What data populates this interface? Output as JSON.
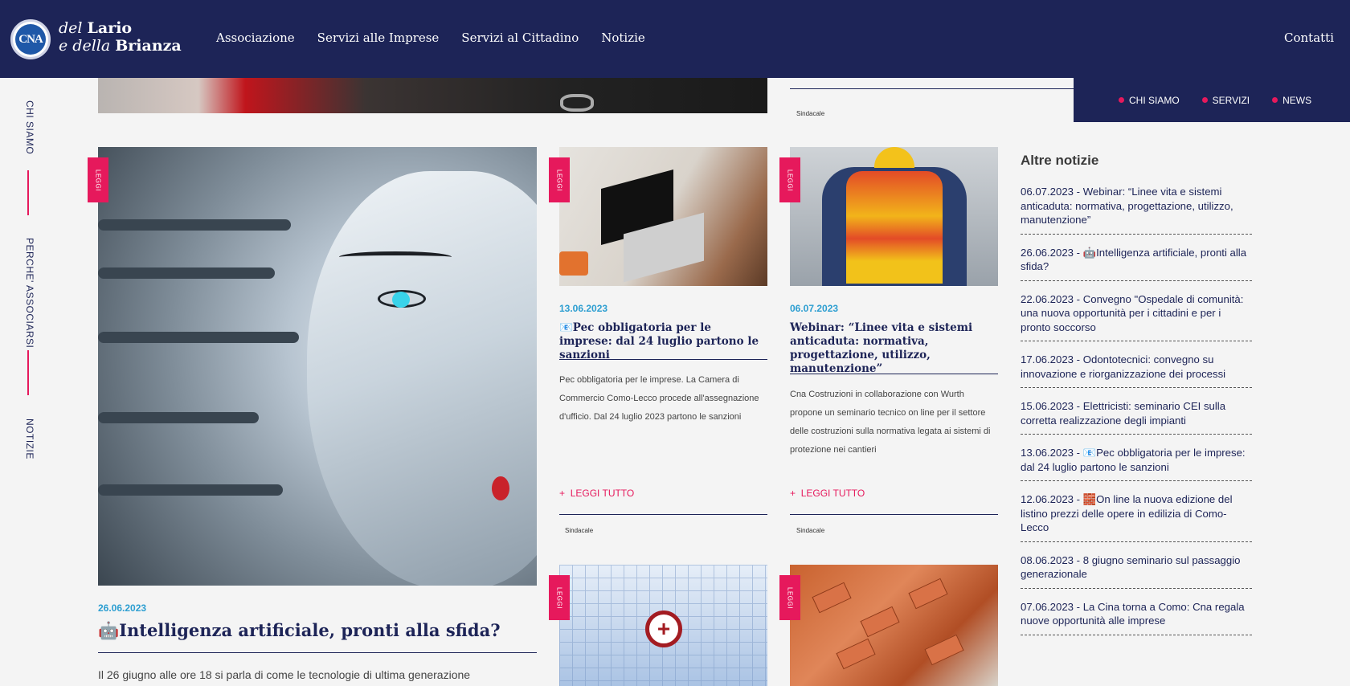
{
  "header": {
    "logo_text": "CNA",
    "brand_line1_italic": "del",
    "brand_line1_bold": "Lario",
    "brand_line2_italic": "e della",
    "brand_line2_bold": "Brianza",
    "nav": [
      "Associazione",
      "Servizi alle Imprese",
      "Servizi al Cittadino",
      "Notizie"
    ],
    "contact": "Contatti"
  },
  "subnav": [
    "CHI SIAMO",
    "SERVIZI",
    "NEWS"
  ],
  "side_nav": [
    "CHI SIAMO",
    "PERCHE' ASSOCIARSI",
    "NOTIZIE"
  ],
  "top_strip": {
    "tag": "Sindacale"
  },
  "main_card": {
    "tab": "LEGGI",
    "date": "26.06.2023",
    "title": "🤖Intelligenza artificiale, pronti alla sfida?",
    "excerpt": "Il 26 giugno alle ore 18 si parla di come le tecnologie di ultima generazione"
  },
  "cards": [
    {
      "tab": "LEGGI",
      "date": "13.06.2023",
      "title": "📧Pec obbligatoria per le imprese: dal 24 luglio partono le sanzioni",
      "excerpt": "Pec obbligatoria per le imprese. La Camera di Commercio Como-Lecco procede all'assegnazione d'ufficio. Dal 24 luglio 2023 partono le sanzioni",
      "read_more": "LEGGI TUTTO",
      "tag": "Sindacale"
    },
    {
      "tab": "LEGGI",
      "date": "06.07.2023",
      "title": "Webinar: “Linee vita e sistemi anticaduta: normativa, progettazione, utilizzo, manutenzione”",
      "excerpt": "Cna Costruzioni in collaborazione con Wurth propone un seminario tecnico on line per il settore delle costruzioni sulla normativa legata ai sistemi di protezione nei cantieri",
      "read_more": "LEGGI TUTTO",
      "tag": "Sindacale"
    },
    {
      "tab": "LEGGI"
    },
    {
      "tab": "LEGGI"
    }
  ],
  "read_more_prefix": "+",
  "altre": {
    "title": "Altre notizie",
    "items": [
      "06.07.2023 - Webinar: “Linee vita e sistemi anticaduta: normativa, progettazione, utilizzo, manutenzione”",
      "26.06.2023 - 🤖Intelligenza artificiale, pronti alla sfida?",
      "22.06.2023 - Convegno \"Ospedale di comunità: una nuova opportunità per i cittadini e per i pronto soccorso",
      "17.06.2023 - Odontotecnici: convegno su innovazione e riorganizzazione dei processi",
      "15.06.2023 - Elettricisti: seminario CEI sulla corretta realizzazione degli impianti",
      "13.06.2023 - 📧Pec obbligatoria per le imprese: dal 24 luglio partono le sanzioni",
      "12.06.2023 - 🧱On line la nuova edizione del listino prezzi delle opere in edilizia di Como-Lecco",
      "08.06.2023 - 8 giugno seminario sul passaggio generazionale",
      "07.06.2023 - La Cina torna a Como: Cna regala nuove opportunità alle imprese"
    ]
  },
  "colors": {
    "navy": "#1d2457",
    "accent": "#e6195c",
    "date_blue": "#2c9ed1"
  }
}
